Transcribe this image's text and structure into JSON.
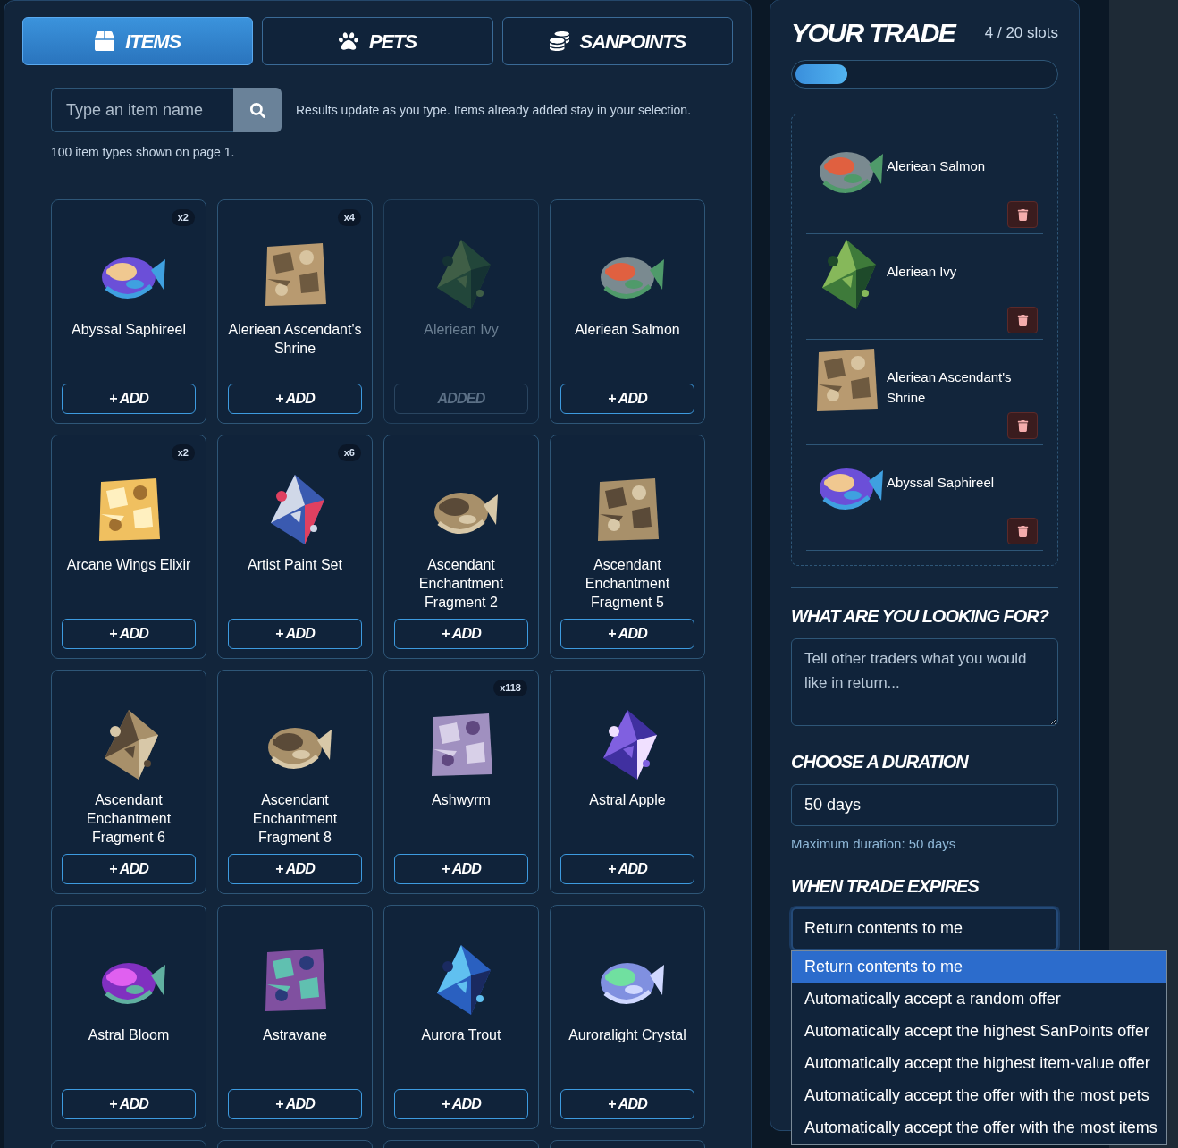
{
  "tabs": [
    {
      "label": "ITEMS",
      "selected": true
    },
    {
      "label": "PETS",
      "selected": false
    },
    {
      "label": "SANPOINTS",
      "selected": false
    }
  ],
  "search": {
    "placeholder": "Type an item name",
    "hint": "Results update as you type. Items already added stay in your selection.",
    "count_note": "100 item types shown on page 1."
  },
  "items": [
    {
      "name": "Abyssal Saphireel",
      "count": "x2",
      "added": false,
      "button": "+ ADD"
    },
    {
      "name": "Aleriean Ascendant's Shrine",
      "count": "x4",
      "added": false,
      "button": "+ ADD"
    },
    {
      "name": "Aleriean Ivy",
      "added": true,
      "button": "ADDED"
    },
    {
      "name": "Aleriean Salmon",
      "added": false,
      "button": "+ ADD"
    },
    {
      "name": "Arcane Wings Elixir",
      "count": "x2",
      "added": false,
      "button": "+ ADD"
    },
    {
      "name": "Artist Paint Set",
      "count": "x6",
      "added": false,
      "button": "+ ADD"
    },
    {
      "name": "Ascendant Enchantment Fragment 2",
      "added": false,
      "button": "+ ADD"
    },
    {
      "name": "Ascendant Enchantment Fragment 5",
      "added": false,
      "button": "+ ADD"
    },
    {
      "name": "Ascendant Enchantment Fragment 6",
      "added": false,
      "button": "+ ADD"
    },
    {
      "name": "Ascendant Enchantment Fragment 8",
      "added": false,
      "button": "+ ADD"
    },
    {
      "name": "Ashwyrm",
      "count": "x118",
      "added": false,
      "button": "+ ADD"
    },
    {
      "name": "Astral Apple",
      "added": false,
      "button": "+ ADD"
    },
    {
      "name": "Astral Bloom",
      "added": false,
      "button": "+ ADD"
    },
    {
      "name": "Astravane",
      "added": false,
      "button": "+ ADD"
    },
    {
      "name": "Aurora Trout",
      "added": false,
      "button": "+ ADD"
    },
    {
      "name": "Auroralight Crystal",
      "added": false,
      "button": "+ ADD"
    }
  ],
  "trade": {
    "title": "YOUR TRADE",
    "slots": "4 / 20 slots",
    "level": 0.2,
    "items": [
      {
        "name": "Aleriean Salmon"
      },
      {
        "name": "Aleriean Ivy"
      },
      {
        "name": "Aleriean Ascendant's Shrine"
      },
      {
        "name": "Abyssal Saphireel"
      }
    ]
  },
  "looking_for": {
    "heading": "WHAT ARE YOU LOOKING FOR?",
    "placeholder": "Tell other traders what you would like in return..."
  },
  "duration": {
    "heading": "CHOOSE A DURATION",
    "value": "50 days",
    "note": "Maximum duration: 50 days"
  },
  "expires": {
    "heading": "WHEN TRADE EXPIRES",
    "value": "Return contents to me",
    "options": [
      {
        "label": "Return contents to me",
        "selected": true
      },
      {
        "label": "Automatically accept a random offer",
        "selected": false
      },
      {
        "label": "Automatically accept the highest SanPoints offer",
        "selected": false
      },
      {
        "label": "Automatically accept the highest item-value offer",
        "selected": false
      },
      {
        "label": "Automatically accept the offer with the most pets",
        "selected": false
      },
      {
        "label": "Automatically accept the offer with the most items",
        "selected": false
      }
    ]
  }
}
